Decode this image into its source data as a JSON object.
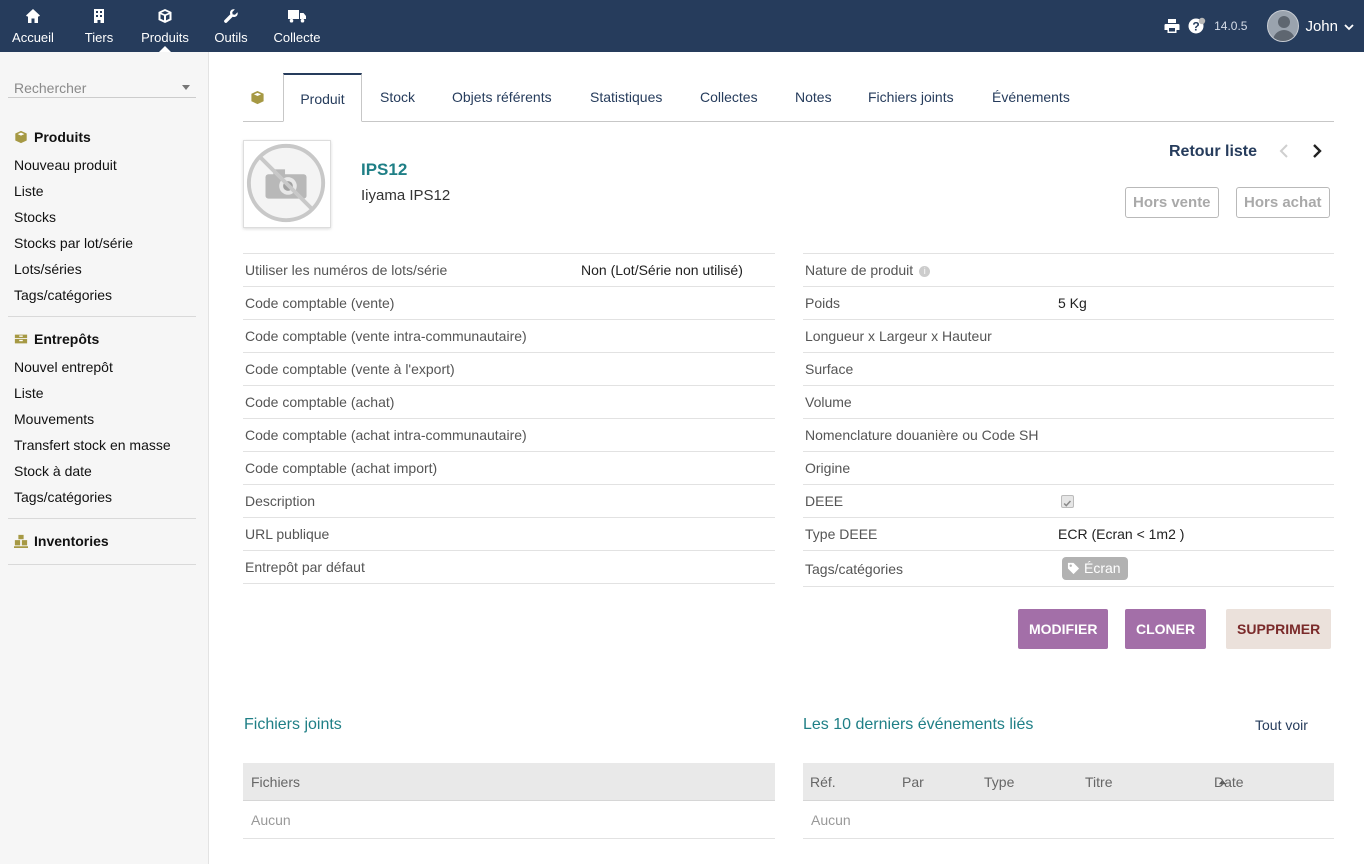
{
  "topnav": {
    "items": [
      {
        "label": "Accueil",
        "icon": "home-icon"
      },
      {
        "label": "Tiers",
        "icon": "building-icon"
      },
      {
        "label": "Produits",
        "icon": "cube-icon"
      },
      {
        "label": "Outils",
        "icon": "wrench-icon"
      },
      {
        "label": "Collecte",
        "icon": "truck-icon"
      }
    ],
    "active": "Produits",
    "version": "14.0.5",
    "user": "John",
    "colors": {
      "bar": "#263c5c"
    }
  },
  "sidebar": {
    "search_placeholder": "Rechercher",
    "produits": {
      "title": "Produits",
      "items": [
        "Nouveau produit",
        "Liste",
        "Stocks",
        "Stocks par lot/série",
        "Lots/séries",
        "Tags/catégories"
      ]
    },
    "entrepots": {
      "title": "Entrepôts",
      "items": [
        "Nouvel entrepôt",
        "Liste",
        "Mouvements",
        "Transfert stock en masse",
        "Stock à date",
        "Tags/catégories"
      ]
    },
    "inventories": {
      "title": "Inventories"
    }
  },
  "tabs": [
    "Produit",
    "Stock",
    "Objets référents",
    "Statistiques",
    "Collectes",
    "Notes",
    "Fichiers joints",
    "Événements"
  ],
  "product": {
    "ref": "IPS12",
    "label": "Iiyama IPS12",
    "back_label": "Retour liste",
    "status_sell": "Hors vente",
    "status_buy": "Hors achat"
  },
  "left_fields": [
    {
      "key": "Utiliser les numéros de lots/série",
      "value": "Non (Lot/Série non utilisé)"
    },
    {
      "key": "Code comptable (vente)",
      "value": ""
    },
    {
      "key": "Code comptable (vente intra-communautaire)",
      "value": ""
    },
    {
      "key": "Code comptable (vente à l'export)",
      "value": ""
    },
    {
      "key": "Code comptable (achat)",
      "value": ""
    },
    {
      "key": "Code comptable (achat intra-communautaire)",
      "value": ""
    },
    {
      "key": "Code comptable (achat import)",
      "value": ""
    },
    {
      "key": "Description",
      "value": ""
    },
    {
      "key": "URL publique",
      "value": ""
    },
    {
      "key": "Entrepôt par défaut",
      "value": ""
    }
  ],
  "right_fields": [
    {
      "key": "Nature de produit",
      "value": ""
    },
    {
      "key": "Poids",
      "value": "5 Kg"
    },
    {
      "key": "Longueur x Largeur x Hauteur",
      "value": ""
    },
    {
      "key": "Surface",
      "value": ""
    },
    {
      "key": "Volume",
      "value": ""
    },
    {
      "key": "Nomenclature douanière ou Code SH",
      "value": ""
    },
    {
      "key": "Origine",
      "value": ""
    },
    {
      "key": "DEEE",
      "value": ""
    },
    {
      "key": "Type DEEE",
      "value": "ECR (Ecran < 1m2 )"
    },
    {
      "key": "Tags/catégories",
      "value": "Écran"
    }
  ],
  "actions": {
    "modify": "MODIFIER",
    "clone": "CLONER",
    "delete": "SUPPRIMER"
  },
  "files": {
    "title": "Fichiers joints",
    "column": "Fichiers",
    "empty": "Aucun"
  },
  "events": {
    "title": "Les 10 derniers événements liés",
    "see_all": "Tout voir",
    "columns": [
      "Réf.",
      "Par",
      "Type",
      "Titre",
      "Date"
    ],
    "empty": "Aucun"
  }
}
